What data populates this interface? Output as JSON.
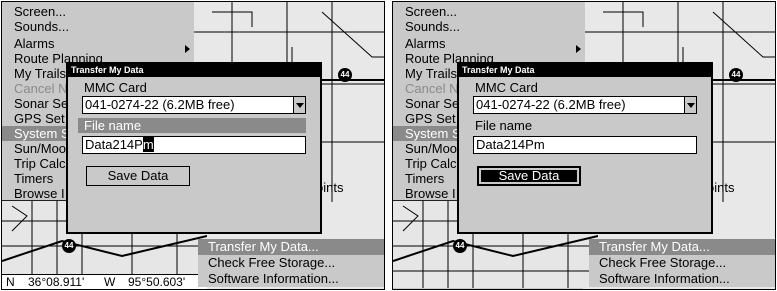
{
  "menu": {
    "items": [
      {
        "label": "Screen..."
      },
      {
        "label": "Sounds..."
      },
      {
        "label": "Alarms"
      },
      {
        "label": "Route Planning"
      },
      {
        "label": "My Trails"
      },
      {
        "label": "Cancel N"
      },
      {
        "label": "Sonar Se"
      },
      {
        "label": "GPS Set"
      },
      {
        "label": "System S"
      },
      {
        "label": "Sun/Moo"
      },
      {
        "label": "Trip Calc"
      },
      {
        "label": "Timers"
      },
      {
        "label": "Browse I"
      }
    ]
  },
  "submenu": {
    "partial_items": [
      {
        "label": "rt..."
      },
      {
        "label": "oints"
      }
    ],
    "items": [
      {
        "label": "Transfer My Data..."
      },
      {
        "label": "Check Free Storage..."
      },
      {
        "label": "Software Information..."
      }
    ]
  },
  "status": {
    "lat_hemi": "N",
    "lat": "36°08.911'",
    "lon_hemi": "W",
    "lon": "95°50.603'"
  },
  "dialog": {
    "title": "Transfer My Data",
    "card_label": "MMC Card",
    "card_value": "041-0274-22 (6.2MB free)",
    "file_label": "File name",
    "file_value": "Data214Pm",
    "file_value_prefix": "Data214P",
    "file_value_cursor": "m",
    "save_label": "Save Data"
  },
  "map": {
    "shield_number": "44"
  }
}
